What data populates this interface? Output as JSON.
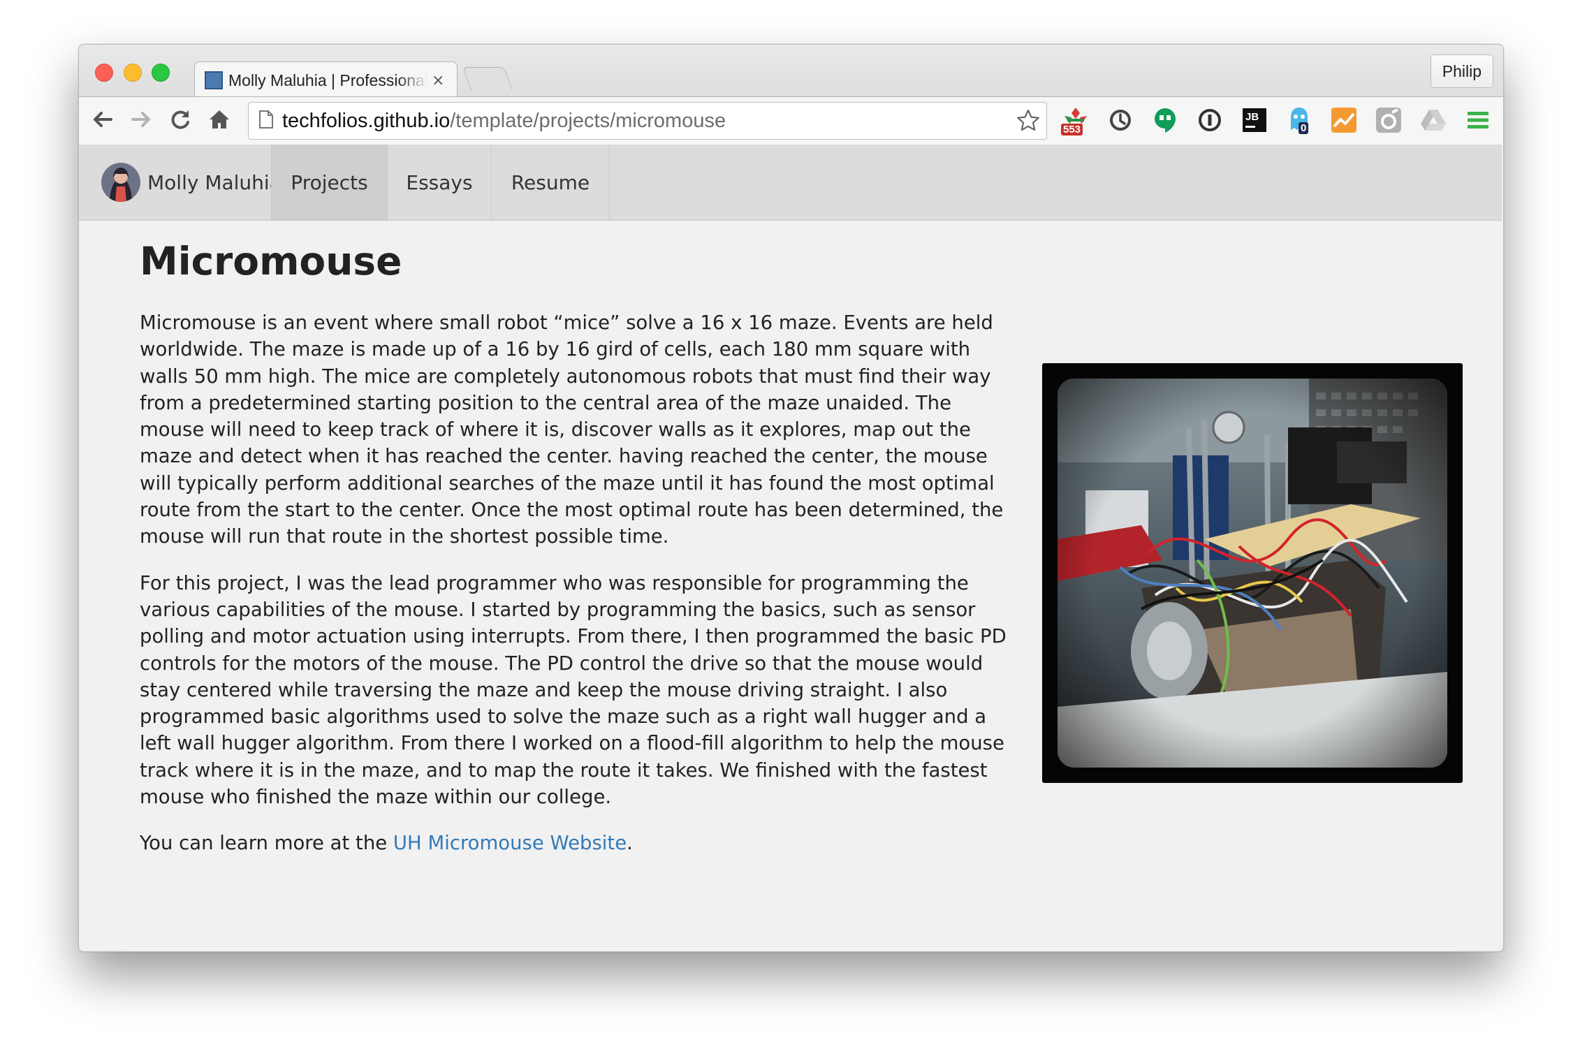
{
  "browser": {
    "tab_title": "Molly Maluhia | Professional Portfolio",
    "tab_close": "×",
    "profile_label": "Philip",
    "url_host": "techfolios.github.io",
    "url_path": "/template/projects/micromouse",
    "nav_buttons": [
      "back-arrow-icon",
      "forward-arrow-icon",
      "reload-icon",
      "home-icon"
    ],
    "extensions": [
      {
        "name": "lastpass-icon",
        "badge": "553"
      },
      {
        "name": "sync-icon",
        "badge": ""
      },
      {
        "name": "hangouts-icon",
        "badge": ""
      },
      {
        "name": "info-icon",
        "badge": ""
      },
      {
        "name": "jetbrains-icon",
        "badge": ""
      },
      {
        "name": "ghostery-icon",
        "badge": "0"
      },
      {
        "name": "analytics-icon",
        "badge": ""
      },
      {
        "name": "whatruns-icon",
        "badge": ""
      },
      {
        "name": "drive-icon",
        "badge": ""
      },
      {
        "name": "menu-icon",
        "badge": ""
      }
    ],
    "colors": {
      "accent_link": "#337ab7",
      "badge_red": "#c8302a",
      "badge_navy": "#1c2a52"
    }
  },
  "site": {
    "brand_name": "Molly Maluhia",
    "nav": [
      {
        "label": "Projects",
        "active": true
      },
      {
        "label": "Essays",
        "active": false
      },
      {
        "label": "Resume",
        "active": false
      }
    ]
  },
  "article": {
    "title": "Micromouse",
    "paragraph1": "Micromouse is an event where small robot “mice” solve a 16 x 16 maze. Events are held worldwide. The maze is made up of a 16 by 16 gird of cells, each 180 mm square with walls 50 mm high. The mice are completely autonomous robots that must find their way from a predetermined starting position to the central area of the maze unaided. The mouse will need to keep track of where it is, discover walls as it explores, map out the maze and detect when it has reached the center. having reached the center, the mouse will typically perform additional searches of the maze until it has found the most optimal route from the start to the center. Once the most optimal route has been determined, the mouse will run that route in the shortest possible time.",
    "paragraph2": "For this project, I was the lead programmer who was responsible for programming the various capabilities of the mouse. I started by programming the basics, such as sensor polling and motor actuation using interrupts. From there, I then programmed the basic PD controls for the motors of the mouse. The PD control the drive so that the mouse would stay centered while traversing the maze and keep the mouse driving straight. I also programmed basic algorithms used to solve the maze such as a right wall hugger and a left wall hugger algorithm. From there I worked on a flood-fill algorithm to help the mouse track where it is in the maze, and to map the route it takes. We finished with the fastest mouse who finished the maze within our college.",
    "learn_more_prefix": "You can learn more at the ",
    "learn_more_link": "UH Micromouse Website",
    "learn_more_suffix": "."
  }
}
